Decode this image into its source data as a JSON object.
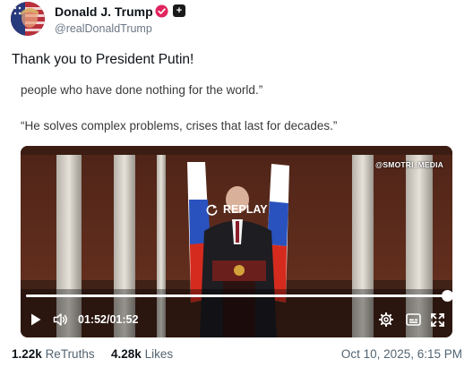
{
  "author": {
    "name": "Donald J. Trump",
    "handle": "@realDonaldTrump",
    "avatar_icon": "avatar-flag-portrait-icon",
    "verified_icon": "verified-check-icon",
    "badge_icon": "plus-badge-icon"
  },
  "post": {
    "text": "Thank you to President Putin!"
  },
  "media": {
    "quote_1": "people who have done nothing for the world.”",
    "quote_2": "“He solves complex problems, crises that last for decades.”",
    "video": {
      "watermark": "@SMOTRI_MEDIA",
      "replay_label": "REPLAY",
      "time_display": "01:52/01:52",
      "progress": 1.0,
      "controls": [
        "play-icon",
        "volume-icon",
        "settings-gear-icon",
        "captions-icon",
        "fullscreen-icon"
      ]
    }
  },
  "stats": {
    "retruths_count": "1.22k",
    "retruths_label": "ReTruths",
    "likes_count": "4.28k",
    "likes_label": "Likes",
    "timestamp": "Oct 10, 2025, 6:15 PM"
  },
  "colors": {
    "verified": "#e0245e",
    "text_primary": "#0f1419",
    "text_secondary": "#536471"
  }
}
